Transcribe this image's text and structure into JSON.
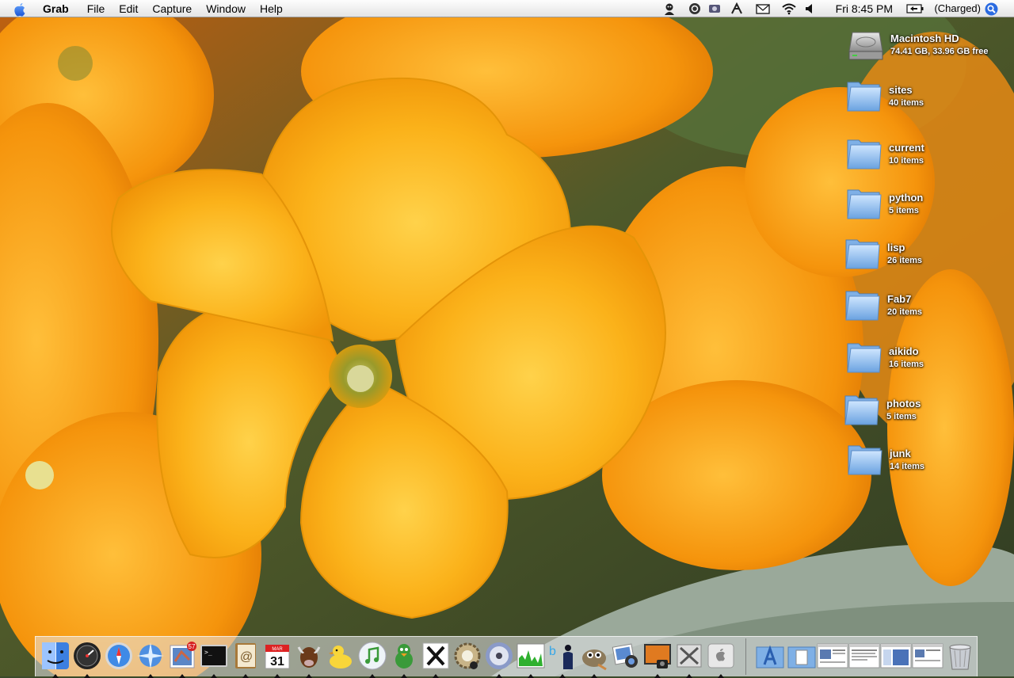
{
  "menubar": {
    "app_name": "Grab",
    "menus": [
      "File",
      "Edit",
      "Capture",
      "Window",
      "Help"
    ],
    "clock": "Fri 8:45 PM",
    "battery": "(Charged)",
    "status_icons": [
      "adium-icon",
      "sync-icon",
      "cog-icon",
      "network-icon",
      "mail-icon",
      "wifi-icon",
      "volume-icon",
      "battery-icon",
      "spotlight-icon"
    ]
  },
  "desktop": {
    "icons": [
      {
        "name": "Macintosh HD",
        "info": "74.41 GB, 33.96 GB free",
        "kind": "hard-drive"
      },
      {
        "name": "sites",
        "info": "40 items",
        "kind": "folder"
      },
      {
        "name": "current",
        "info": "10 items",
        "kind": "folder"
      },
      {
        "name": "python",
        "info": "5 items",
        "kind": "folder"
      },
      {
        "name": "lisp",
        "info": "26 items",
        "kind": "folder"
      },
      {
        "name": "Fab7",
        "info": "20 items",
        "kind": "folder"
      },
      {
        "name": "aikido",
        "info": "16 items",
        "kind": "folder"
      },
      {
        "name": "photos",
        "info": "5 items",
        "kind": "folder"
      },
      {
        "name": "junk",
        "info": "14 items",
        "kind": "folder"
      }
    ]
  },
  "dock": {
    "apps": [
      {
        "name": "finder-icon",
        "running": true
      },
      {
        "name": "dashboard-icon",
        "running": true
      },
      {
        "name": "safari-icon",
        "running": false
      },
      {
        "name": "network-browser-icon",
        "running": true
      },
      {
        "name": "mail-stamp-icon",
        "running": true,
        "badge": "57"
      },
      {
        "name": "terminal-icon",
        "running": true
      },
      {
        "name": "address-book-icon",
        "running": true
      },
      {
        "name": "ical-icon",
        "running": true,
        "date": "31",
        "month": "MAR"
      },
      {
        "name": "gnu-icon",
        "running": true
      },
      {
        "name": "cyberduck-icon",
        "running": false
      },
      {
        "name": "itunes-icon",
        "running": true
      },
      {
        "name": "adium-duck-icon",
        "running": true
      },
      {
        "name": "x11-icon",
        "running": true
      },
      {
        "name": "gear-camera-icon",
        "running": false
      },
      {
        "name": "disk-utility-icon",
        "running": true
      },
      {
        "name": "activity-monitor-icon",
        "running": true
      },
      {
        "name": "twitter-person-icon",
        "running": true
      },
      {
        "name": "gimp-icon",
        "running": true
      },
      {
        "name": "iphoto-icon",
        "running": false
      },
      {
        "name": "image-capture-icon",
        "running": true
      },
      {
        "name": "system-tools-icon",
        "running": true
      },
      {
        "name": "apple-prefs-icon",
        "running": true
      }
    ],
    "stacks": [
      {
        "name": "applications-stack-icon"
      },
      {
        "name": "documents-stack-icon"
      },
      {
        "name": "minimized-window-1-icon"
      },
      {
        "name": "minimized-window-2-icon"
      },
      {
        "name": "minimized-window-3-icon"
      },
      {
        "name": "minimized-window-4-icon"
      },
      {
        "name": "trash-icon"
      }
    ]
  }
}
